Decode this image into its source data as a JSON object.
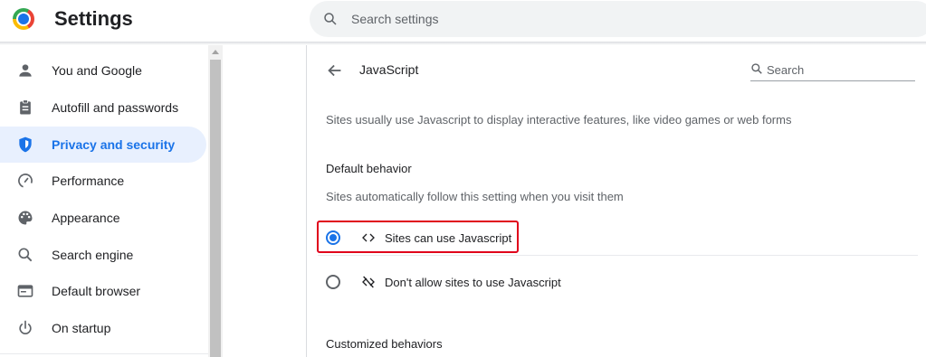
{
  "app": {
    "title": "Settings"
  },
  "search": {
    "placeholder": "Search settings"
  },
  "sidebar": {
    "items": [
      {
        "label": "You and Google",
        "icon": "person-icon"
      },
      {
        "label": "Autofill and passwords",
        "icon": "clipboard-icon"
      },
      {
        "label": "Privacy and security",
        "icon": "shield-icon",
        "active": true
      },
      {
        "label": "Performance",
        "icon": "gauge-icon"
      },
      {
        "label": "Appearance",
        "icon": "palette-icon"
      },
      {
        "label": "Search engine",
        "icon": "search-icon"
      },
      {
        "label": "Default browser",
        "icon": "browser-window-icon"
      },
      {
        "label": "On startup",
        "icon": "power-icon"
      }
    ]
  },
  "page": {
    "title": "JavaScript",
    "search_placeholder": "Search",
    "description": "Sites usually use Javascript to display interactive features, like video games or web forms",
    "default_behavior": {
      "heading": "Default behavior",
      "subtitle": "Sites automatically follow this setting when you visit them",
      "options": [
        {
          "label": "Sites can use Javascript",
          "icon": "code-icon",
          "selected": true
        },
        {
          "label": "Don't allow sites to use Javascript",
          "icon": "code-off-icon",
          "selected": false
        }
      ]
    },
    "customized_heading": "Customized behaviors"
  },
  "colors": {
    "accent": "#1a73e8",
    "active_nav_bg": "#e8f0fe",
    "highlight_box": "#e0001b"
  }
}
